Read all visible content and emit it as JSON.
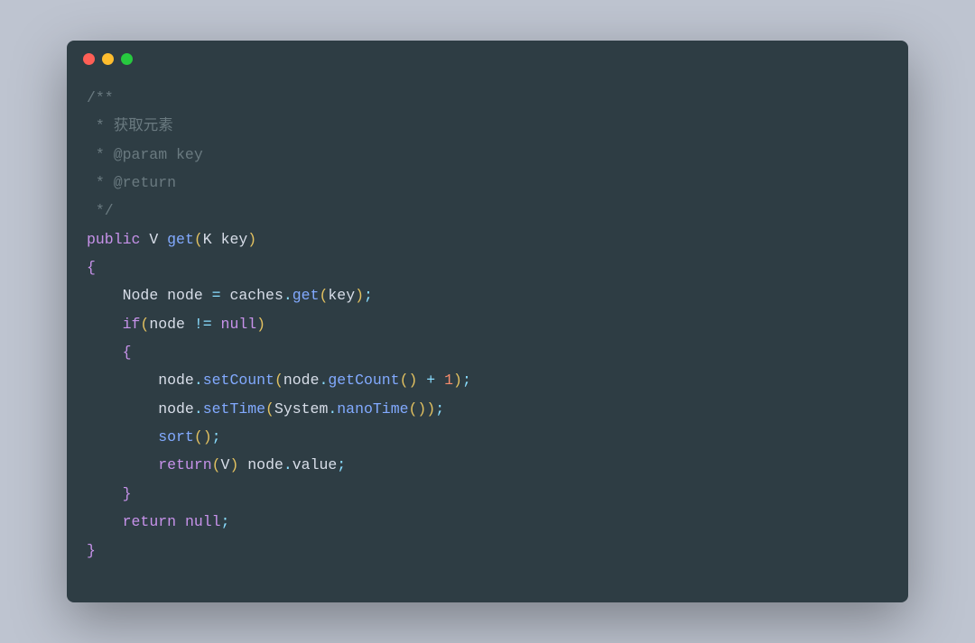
{
  "window": {
    "dots": [
      "red",
      "yellow",
      "green"
    ]
  },
  "code": {
    "c1": "/**",
    "c2": " * 获取元素",
    "c3": " * @param key",
    "c4": " * @return",
    "c5": " */",
    "kw_public": "public",
    "type_V": "V",
    "fn_get": "get",
    "type_K": "K",
    "param_key": "key",
    "lbrace": "{",
    "rbrace": "}",
    "type_Node": "Node",
    "var_node": "node",
    "eq": " = ",
    "var_caches": "caches",
    "dot": ".",
    "call_get": "get",
    "arg_key": "key",
    "semi": ";",
    "kw_if": "if",
    "neq": " != ",
    "kw_null": "null",
    "call_setCount": "setCount",
    "call_getCount": "getCount",
    "plus": " + ",
    "num_1": "1",
    "call_setTime": "setTime",
    "sys": "System",
    "call_nanoTime": "nanoTime",
    "call_sort": "sort",
    "kw_return": "return",
    "field_value": "value",
    "sp": " ",
    "indent1": "    ",
    "indent2": "        ",
    "lparen": "(",
    "rparen": ")"
  }
}
